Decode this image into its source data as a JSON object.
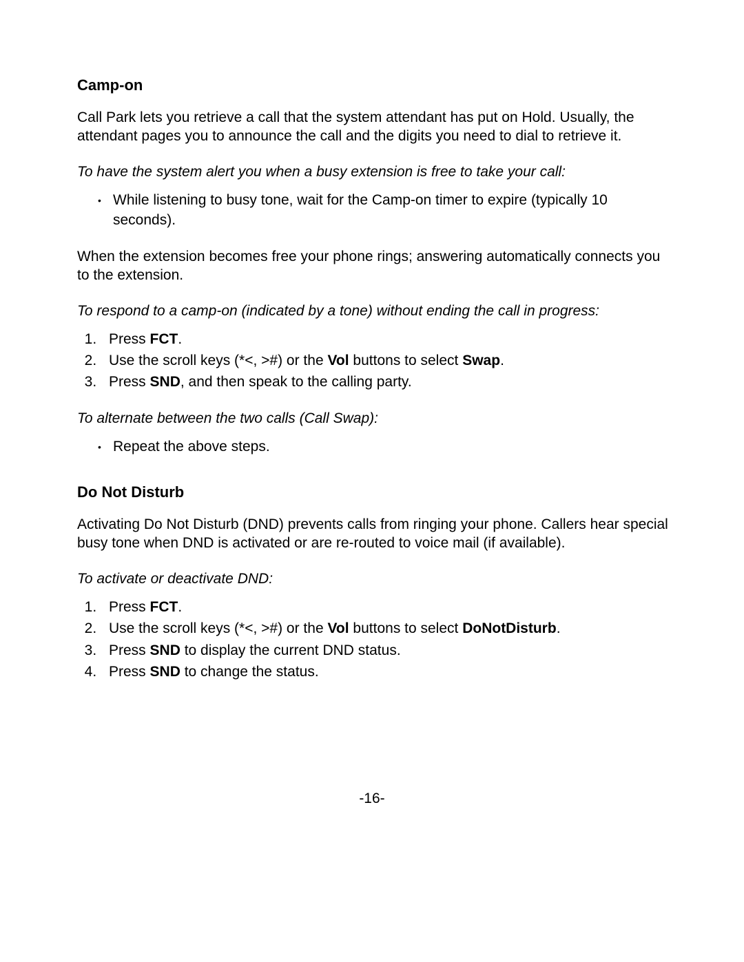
{
  "section1": {
    "heading": "Camp-on",
    "intro": "Call Park lets you retrieve a call that the system attendant has put on Hold. Usually, the attendant pages you to announce the call and the digits you need to dial to retrieve it.",
    "sub1": "To have the system alert you when a busy extension is free to take your call:",
    "bullet1": "While listening to busy tone, wait for the Camp-on timer to expire (typically 10 seconds).",
    "para2": "When the extension becomes free your phone rings; answering automatically connects you to the extension.",
    "sub2": "To respond to a camp-on (indicated by a tone) without ending the call in progress:",
    "ol1": {
      "i1_a": "Press ",
      "i1_b": "FCT",
      "i1_c": ".",
      "i2_a": "Use the scroll keys (*<, >#) or the ",
      "i2_b": "Vol",
      "i2_c": " buttons to select ",
      "i2_d": "Swap",
      "i2_e": ".",
      "i3_a": "Press ",
      "i3_b": "SND",
      "i3_c": ", and then speak to the calling party."
    },
    "sub3": "To alternate between the two calls (Call Swap):",
    "bullet2": "Repeat the above steps."
  },
  "section2": {
    "heading": "Do Not Disturb",
    "intro": "Activating Do Not Disturb (DND) prevents calls from ringing your phone. Callers hear special busy tone when DND is activated or are re-routed to voice mail (if available).",
    "sub1": "To activate or deactivate DND:",
    "ol1": {
      "i1_a": "Press ",
      "i1_b": "FCT",
      "i1_c": ".",
      "i2_a": "Use the scroll keys (*<, >#) or the ",
      "i2_b": "Vol",
      "i2_c": " buttons to select ",
      "i2_d": "DoNotDisturb",
      "i2_e": ".",
      "i3_a": "Press ",
      "i3_b": "SND",
      "i3_c": " to display the current DND status.",
      "i4_a": "Press ",
      "i4_b": "SND",
      "i4_c": " to change the status."
    }
  },
  "pageNumber": "-16-"
}
